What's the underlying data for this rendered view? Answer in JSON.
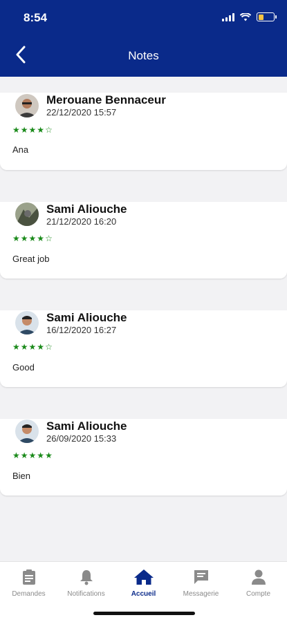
{
  "status": {
    "time": "8:54"
  },
  "header": {
    "title": "Notes"
  },
  "reviews": [
    {
      "name": "Merouane Bennaceur",
      "date": "22/12/2020 15:57",
      "rating": 4,
      "max": 5,
      "comment": "Ana"
    },
    {
      "name": "Sami Aliouche",
      "date": "21/12/2020 16:20",
      "rating": 4,
      "max": 5,
      "comment": "Great job"
    },
    {
      "name": "Sami Aliouche",
      "date": "16/12/2020 16:27",
      "rating": 4,
      "max": 5,
      "comment": "Good"
    },
    {
      "name": "Sami Aliouche",
      "date": "26/09/2020 15:33",
      "rating": 5,
      "max": 5,
      "comment": "Bien"
    }
  ],
  "tabs": [
    {
      "label": "Demandes",
      "icon": "clipboard-icon",
      "active": false
    },
    {
      "label": "Notifications",
      "icon": "bell-icon",
      "active": false
    },
    {
      "label": "Accueil",
      "icon": "home-icon",
      "active": true
    },
    {
      "label": "Messagerie",
      "icon": "message-icon",
      "active": false
    },
    {
      "label": "Compte",
      "icon": "user-icon",
      "active": false
    }
  ],
  "colors": {
    "header": "#0a2a8a",
    "stars": "#1a8a1a",
    "active_tab": "#0a2a8a",
    "inactive_tab": "#8a8a8a"
  }
}
